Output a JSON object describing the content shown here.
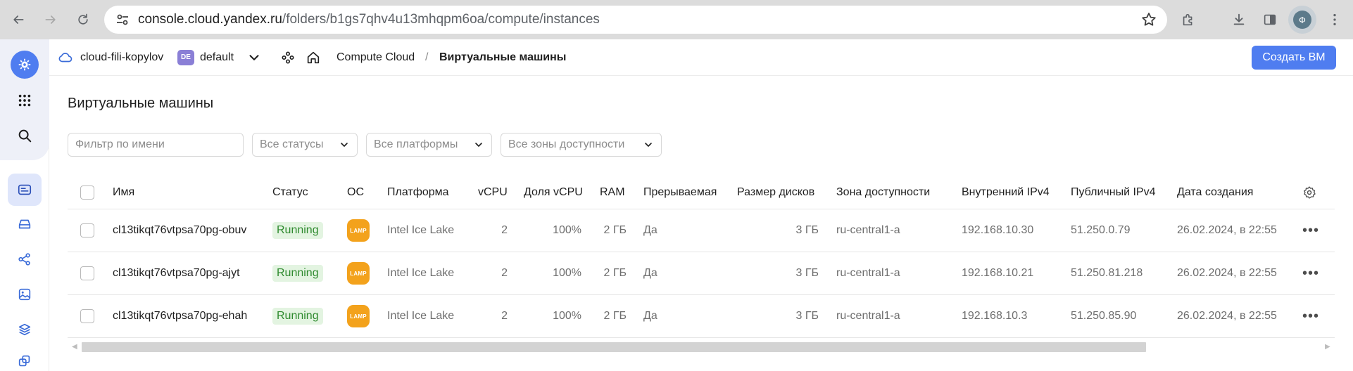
{
  "browser": {
    "url_host": "console.cloud.yandex.ru",
    "url_path": "/folders/b1gs7qhv4u13mhqpm6oa/compute/instances",
    "profile_initial": "Ф"
  },
  "header": {
    "cloud_name": "cloud-fili-kopylov",
    "folder_badge": "DE",
    "folder_name": "default",
    "breadcrumb_service": "Compute Cloud",
    "breadcrumb_separator": "/",
    "breadcrumb_current": "Виртуальные машины",
    "create_button": "Создать ВМ"
  },
  "page": {
    "title": "Виртуальные машины"
  },
  "filters": {
    "name_placeholder": "Фильтр по имени",
    "status": "Все статусы",
    "platform": "Все платформы",
    "zone": "Все зоны доступности"
  },
  "table": {
    "columns": {
      "name": "Имя",
      "status": "Статус",
      "os": "ОС",
      "platform": "Платформа",
      "vcpu": "vCPU",
      "vcpu_share": "Доля vCPU",
      "ram": "RAM",
      "preemptible": "Прерываемая",
      "disk_size": "Размер дисков",
      "zone": "Зона доступности",
      "internal_ip": "Внутренний IPv4",
      "public_ip": "Публичный IPv4",
      "created": "Дата создания"
    },
    "rows": [
      {
        "name": "cl13tikqt76vtpsa70pg-obuv",
        "status": "Running",
        "os": "LAMP",
        "platform": "Intel Ice Lake",
        "vcpu": "2",
        "vcpu_share": "100%",
        "ram": "2 ГБ",
        "preemptible": "Да",
        "disk_size": "3 ГБ",
        "zone": "ru-central1-a",
        "internal_ip": "192.168.10.30",
        "public_ip": "51.250.0.79",
        "created": "26.02.2024, в 22:55",
        "menu": "•••"
      },
      {
        "name": "cl13tikqt76vtpsa70pg-ajyt",
        "status": "Running",
        "os": "LAMP",
        "platform": "Intel Ice Lake",
        "vcpu": "2",
        "vcpu_share": "100%",
        "ram": "2 ГБ",
        "preemptible": "Да",
        "disk_size": "3 ГБ",
        "zone": "ru-central1-a",
        "internal_ip": "192.168.10.21",
        "public_ip": "51.250.81.218",
        "created": "26.02.2024, в 22:55",
        "menu": "•••"
      },
      {
        "name": "cl13tikqt76vtpsa70pg-ehah",
        "status": "Running",
        "os": "LAMP",
        "platform": "Intel Ice Lake",
        "vcpu": "2",
        "vcpu_share": "100%",
        "ram": "2 ГБ",
        "preemptible": "Да",
        "disk_size": "3 ГБ",
        "zone": "ru-central1-a",
        "internal_ip": "192.168.10.3",
        "public_ip": "51.250.85.90",
        "created": "26.02.2024, в 22:55",
        "menu": "•••"
      }
    ]
  },
  "colors": {
    "accent": "#4f7df0",
    "running_bg": "#e3f4e1",
    "running_text": "#2e8a2e",
    "lamp_icon": "#f3a21c"
  },
  "icons": {
    "rail": [
      "logo-icon",
      "apps-grid-icon",
      "search-icon",
      "server-list-icon",
      "disk-icon",
      "network-icon",
      "image-icon",
      "layers-icon",
      "instance-groups-icon"
    ]
  }
}
